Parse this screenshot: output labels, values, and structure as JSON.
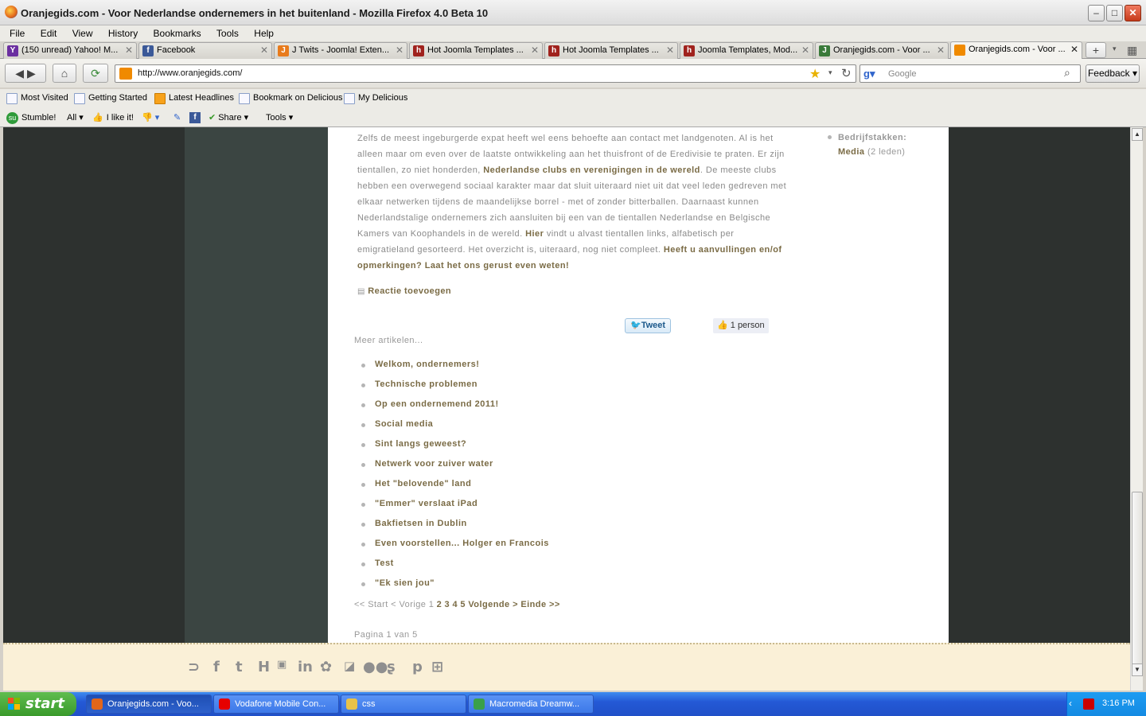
{
  "window": {
    "title": "Oranjegids.com - Voor Nederlandse ondernemers in het buitenland - Mozilla Firefox 4.0 Beta 10"
  },
  "menu": [
    "File",
    "Edit",
    "View",
    "History",
    "Bookmarks",
    "Tools",
    "Help"
  ],
  "tabs": [
    {
      "label": "(150 unread) Yahoo! M...",
      "color": "#6b2fa0",
      "glyph": "Y"
    },
    {
      "label": "Facebook",
      "color": "#3b5998",
      "glyph": "f"
    },
    {
      "label": "J Twits - Joomla! Exten...",
      "color": "#e87b1c",
      "glyph": "J"
    },
    {
      "label": "Hot Joomla Templates ...",
      "color": "#a0221d",
      "glyph": "h"
    },
    {
      "label": "Hot Joomla Templates ...",
      "color": "#a0221d",
      "glyph": "h"
    },
    {
      "label": "Joomla Templates, Mod...",
      "color": "#a0221d",
      "glyph": "h"
    },
    {
      "label": "Oranjegids.com - Voor ...",
      "color": "#3a7a3a",
      "glyph": "J"
    },
    {
      "label": "Oranjegids.com - Voor ...",
      "color": "#f08a00",
      "glyph": ""
    }
  ],
  "nav": {
    "url": "http://www.oranjegids.com/",
    "search_placeholder": "Google",
    "feedback": "Feedback"
  },
  "bookmarks": [
    "Most Visited",
    "Getting Started",
    "Latest Headlines",
    "Bookmark on Delicious",
    "My Delicious"
  ],
  "stumble": {
    "stumble": "Stumble!",
    "all": "All",
    "like": "I like it!",
    "share": "Share",
    "tools": "Tools"
  },
  "article": {
    "p1": "Zelfs de meest ingeburgerde expat heeft wel eens behoefte aan contact met landgenoten. Al is het alleen maar om even over de laatste ontwikkeling aan het thuisfront of de Eredivisie te praten. Er zijn tientallen, zo niet honderden, ",
    "l1": "Nederlandse clubs en verenigingen in de wereld",
    "p2": ". De meeste clubs hebben een overwegend sociaal karakter maar dat sluit uiteraard niet uit dat veel leden gedreven met elkaar netwerken tijdens de maandelijkse borrel - met of zonder bitterballen. Daarnaast kunnen Nederlandstalige ondernemers zich aansluiten bij een van de tientallen Nederlandse en Belgische Kamers van Koophandels in de wereld. ",
    "l2": "Hier",
    "p3": " vindt u alvast tientallen links, alfabetisch per emigratieland gesorteerd. Het overzicht is, uiteraard, nog niet compleet. ",
    "l3": "Heeft u aanvullingen en/of opmerkingen? Laat het ons gerust even weten!",
    "comment": "Reactie toevoegen",
    "tweet": "Tweet",
    "like": "1 person",
    "more": "Meer artikelen...",
    "articles": [
      "Welkom, ondernemers!",
      "Technische problemen",
      "Op een ondernemend 2011!",
      "Social media",
      "Sint langs geweest?",
      "Netwerk voor zuiver water",
      "Het \"belovende\" land",
      "\"Emmer\" verslaat iPad",
      "Bakfietsen in Dublin",
      "Even voorstellen... Holger en Francois",
      "Test",
      "\"Ek sien jou\""
    ],
    "pager": {
      "start": "<< Start",
      "prev": "< Vorige",
      "current": "1",
      "pages": [
        "2",
        "3",
        "4",
        "5"
      ],
      "next": "Volgende >",
      "end": "Einde >>"
    },
    "page_info": "Pagina 1 van 5"
  },
  "sidebar": {
    "label": "Bedrijfstakken:",
    "link": "Media",
    "count": "(2 leden)"
  },
  "taskbar": {
    "start": "start",
    "tasks": [
      {
        "label": "Oranjegids.com - Voo...",
        "color": "#e2661a"
      },
      {
        "label": "Vodafone Mobile Con...",
        "color": "#e60000"
      },
      {
        "label": "css",
        "color": "#e8c24a"
      },
      {
        "label": "Macromedia Dreamw...",
        "color": "#3aa04a"
      }
    ],
    "clock": "3:16 PM"
  },
  "colors": {
    "accent": "#7a6b45",
    "footer_bg": "#faf0d7",
    "page_dark": "#2d312f"
  }
}
